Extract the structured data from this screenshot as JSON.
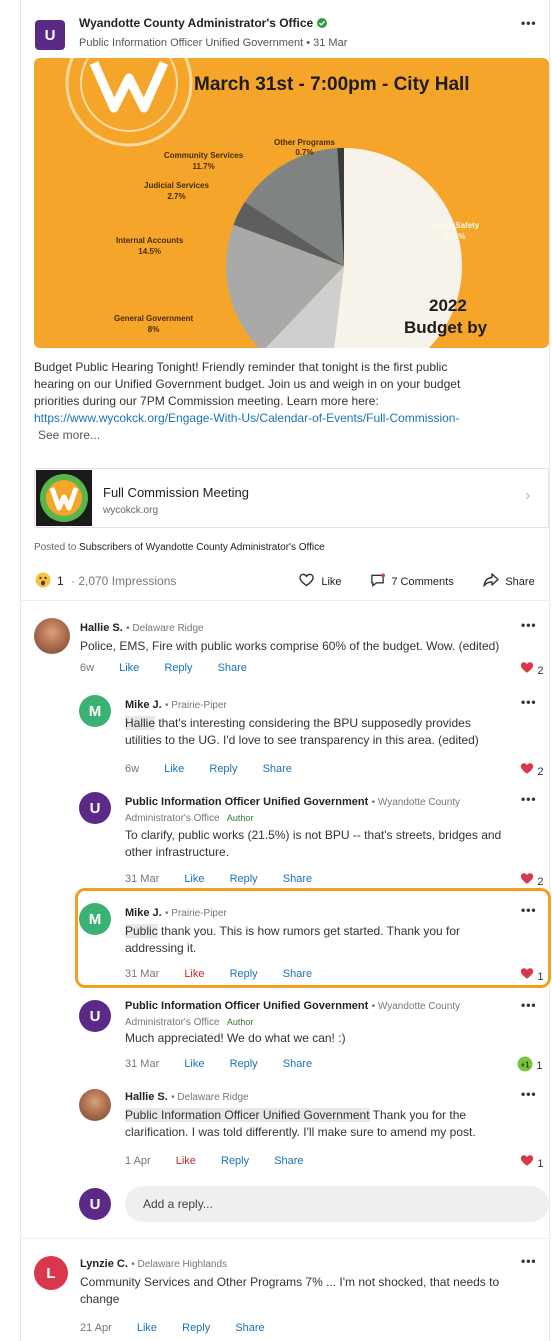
{
  "post": {
    "org_name": "Wyandotte County Administrator's Office",
    "subtitle": "Public Information Officer Unified Government • 31 Mar",
    "avatar_letter": "U",
    "image": {
      "headline": "March 31st - 7:00pm - City Hall",
      "year": "2022",
      "budget_by": "Budget by",
      "slices": [
        {
          "label": "Public Safety",
          "value": "40.6%",
          "pct": 40.6,
          "color": "#f7f3ea"
        },
        {
          "label": "General Government",
          "value": "8%",
          "pct": 8,
          "color": "#cfcfcf"
        },
        {
          "label": "Internal Accounts",
          "value": "14.5%",
          "pct": 14.5,
          "color": "#a9aaa7"
        },
        {
          "label": "Judicial Services",
          "value": "2.7%",
          "pct": 2.7,
          "color": "#5d5f5e"
        },
        {
          "label": "Community Services",
          "value": "11.7%",
          "pct": 11.7,
          "color": "#7f8381"
        },
        {
          "label": "Other Programs",
          "value": "0.7%",
          "pct": 0.7,
          "color": "#3a3c3b"
        }
      ],
      "orange": "#f4a52a"
    },
    "body_lines": [
      "Budget Public Hearing Tonight! Friendly reminder that tonight is the first public",
      "hearing on our Unified Government budget. Join us and weigh in on your budget",
      "priorities during our 7PM Commission meeting. Learn more here:"
    ],
    "link": "https://www.wycokck.org/Engage-With-Us/Calendar-of-Events/Full-Commission-",
    "see_more": "See more...",
    "preview": {
      "title": "Full Commission Meeting",
      "domain": "wycokck.org"
    },
    "posted_to_prefix": "Posted to ",
    "posted_to": "Subscribers of Wyandotte County Administrator's Office",
    "reaction_count": "1",
    "impressions": "· 2,070 Impressions",
    "like_label": "Like",
    "comments_label": "7 Comments",
    "share_label": "Share"
  },
  "comments": [
    {
      "name": "Hallie S.",
      "location": "• Delaware Ridge",
      "text_lines": [
        "Police, EMS, Fire with public works comprise 60% of the budget. Wow. (edited)"
      ],
      "time": "6w",
      "like": "Like",
      "reply": "Reply",
      "share": "Share",
      "reactions": "2"
    },
    {
      "name": "Mike J.",
      "location": "• Prairie-Piper",
      "avatar_letter": "M",
      "mention": "Hallie",
      "text_lines": [
        " that's interesting considering the BPU supposedly provides",
        "utilities to the UG. I'd love to see transparency in this area. (edited)"
      ],
      "time": "6w",
      "like": "Like",
      "reply": "Reply",
      "share": "Share",
      "reactions": "2"
    },
    {
      "name": "Public Information Officer Unified Government",
      "location": "• Wyandotte County",
      "org_line": "Administrator's Office",
      "author_tag": "Author",
      "avatar_letter": "U",
      "text_lines": [
        "To clarify, public works (21.5%) is not BPU -- that's streets, bridges and",
        "other infrastructure."
      ],
      "time": "31 Mar",
      "like": "Like",
      "reply": "Reply",
      "share": "Share",
      "reactions": "2"
    },
    {
      "name": "Mike J.",
      "location": "• Prairie-Piper",
      "avatar_letter": "M",
      "mention": "Public",
      "text_lines": [
        " thank you. This is how rumors get started. Thank you for",
        "addressing it."
      ],
      "time": "31 Mar",
      "like": "Like",
      "reply": "Reply",
      "share": "Share",
      "reactions": "1"
    },
    {
      "name": "Public Information Officer Unified Government",
      "location": "• Wyandotte County",
      "org_line": "Administrator's Office",
      "author_tag": "Author",
      "avatar_letter": "U",
      "text_lines": [
        "Much appreciated! We do what we can! :)"
      ],
      "time": "31 Mar",
      "like": "Like",
      "reply": "Reply",
      "share": "Share",
      "reactions": "1"
    },
    {
      "name": "Hallie S.",
      "location": "• Delaware Ridge",
      "mention": "Public Information Officer Unified Government",
      "text_lines": [
        " Thank you for the",
        "clarification. I was told differently. I'll make sure to amend my post."
      ],
      "time": "1 Apr",
      "like": "Like",
      "reply": "Reply",
      "share": "Share",
      "reactions": "1"
    }
  ],
  "reply_box": {
    "placeholder": "Add a reply...",
    "avatar_letter": "U"
  },
  "last_comment": {
    "name": "Lynzie C.",
    "location": "• Delaware Highlands",
    "avatar_letter": "L",
    "text_lines": [
      "Community Services and Other Programs 7% ... I'm not shocked, that needs to",
      "change"
    ],
    "time": "21 Apr",
    "like": "Like",
    "reply": "Reply",
    "share": "Share"
  },
  "more_label": "•••",
  "colors": {
    "purple": "#5b2a86",
    "green": "#3bb273",
    "red": "#d9374b",
    "highlight": "#f0a020",
    "link": "#1a73b8"
  }
}
